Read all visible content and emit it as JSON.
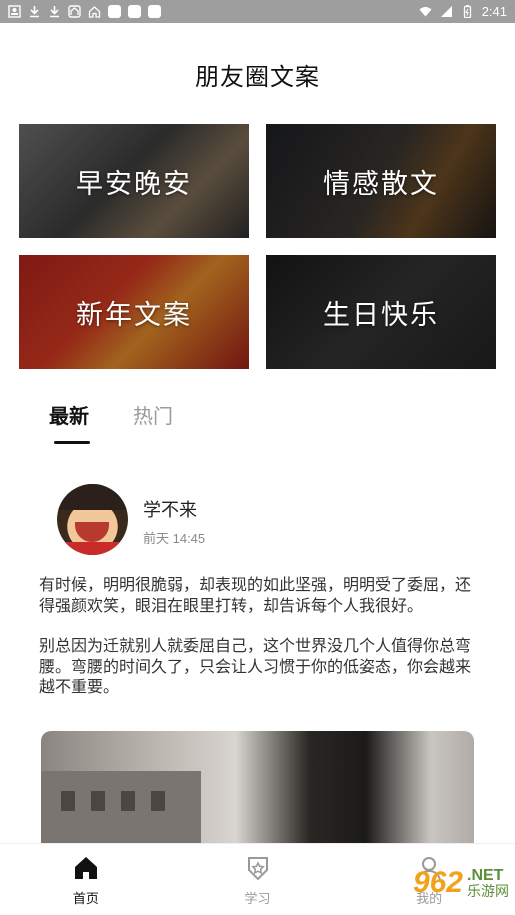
{
  "status_bar": {
    "time": "2:41",
    "icons": [
      "image-icon",
      "download-icon",
      "download-icon",
      "home-icon",
      "app-icon",
      "app-icon",
      "app-icon",
      "app-icon"
    ],
    "right_icons": [
      "wifi-icon",
      "signal-icon",
      "battery-icon"
    ]
  },
  "header": {
    "title": "朋友圈文案"
  },
  "categories": [
    {
      "label": "早安晚安"
    },
    {
      "label": "情感散文"
    },
    {
      "label": "新年文案"
    },
    {
      "label": "生日快乐"
    }
  ],
  "tabs": [
    {
      "label": "最新",
      "active": true
    },
    {
      "label": "热门",
      "active": false
    }
  ],
  "post": {
    "username": "学不来",
    "time": "前天 14:45",
    "paragraphs": [
      "有时候，明明很脆弱，却表现的如此坚强，明明受了委屈，还得强颜欢笑，眼泪在眼里打转，却告诉每个人我很好。",
      "别总因为迁就别人就委屈自己，这个世界没几个人值得你总弯腰。弯腰的时间久了，只会让人习惯于你的低姿态，你会越来越不重要。"
    ]
  },
  "bottom_nav": [
    {
      "label": "首页",
      "icon": "home-icon",
      "active": true
    },
    {
      "label": "学习",
      "icon": "shield-star-icon",
      "active": false
    },
    {
      "label": "我的",
      "icon": "profile-icon",
      "active": false
    }
  ],
  "watermark": {
    "number": "962",
    "net": ".NET",
    "text": "乐游网"
  },
  "colors": {
    "active": "#111111",
    "inactive": "#9a9a9a",
    "status_bar": "#9e9e9e",
    "watermark_orange": "#f2a21a",
    "watermark_green": "#5a8f3a"
  }
}
